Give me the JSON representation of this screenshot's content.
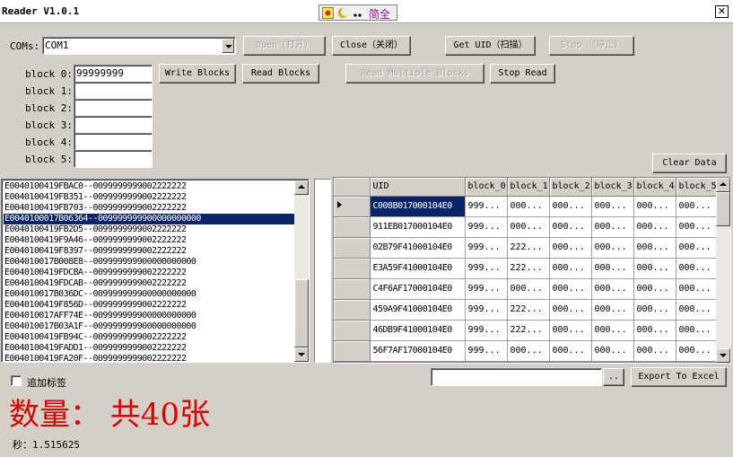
{
  "window": {
    "title": "Reader V1.0.1",
    "close_glyph": "✕"
  },
  "ime": {
    "text": "简全"
  },
  "com": {
    "label": "COMs:",
    "value": "COM1"
  },
  "buttons": {
    "open": "Open（打开）",
    "close": "Close（关闭）",
    "get_uid": "Get UID（扫描）",
    "stop": "Stop （停止）",
    "write_blocks": "Write Blocks",
    "read_blocks": "Read Blocks",
    "read_multiple": "Read Multiple Blocks",
    "stop_read": "Stop Read",
    "clear_data": "Clear Data",
    "export_excel": "Export To Excel",
    "browse": ".."
  },
  "blocks": [
    {
      "label": "block 0:",
      "value": "99999999"
    },
    {
      "label": "block 1:",
      "value": ""
    },
    {
      "label": "block 2:",
      "value": ""
    },
    {
      "label": "block 3:",
      "value": ""
    },
    {
      "label": "block 4:",
      "value": ""
    },
    {
      "label": "block 5:",
      "value": ""
    }
  ],
  "tag_list": {
    "selected_index": 3,
    "items": [
      "E0040100419FBAC0--0099999999002222222",
      "E0040100419FB351--0099999999002222222",
      "E0040100419FB703--0099999999002222222",
      "E0040100017B06364--009999999900000000000",
      "E0040100419FB2D5--0099999999002222222",
      "E0040100419F9A46--0099999999002222222",
      "E0040100419F8397--0099999999002222222",
      "E004010017B008E8--009999999900000000000",
      "E0040100419FDCBA--0099999999002222222",
      "E0040100419FDCAB--0099999999002222222",
      "E004010017B036DC--009999999900000000000",
      "E0040100419F856D--0099999999002222222",
      "E004010017AFF74E--009999999900000000000",
      "E004010017B03A1F--009999999900000000000",
      "E0040100419FB94C--0099999999002222222",
      "E0040100419FADD1--0099999999002222222",
      "E0040100419FA20F--0099999999002222222"
    ]
  },
  "grid": {
    "columns": [
      "UID",
      "block_0",
      "block_1",
      "block_2",
      "block_3",
      "block_4",
      "block_5"
    ],
    "current_row": 0,
    "rows": [
      [
        "C008B017000104E0",
        "999...",
        "000...",
        "000...",
        "000...",
        "000...",
        "000..."
      ],
      [
        "911EB017000104E0",
        "999...",
        "000...",
        "000...",
        "000...",
        "000...",
        "000..."
      ],
      [
        "02B79F41000104E0",
        "999...",
        "222...",
        "000...",
        "000...",
        "000...",
        "000..."
      ],
      [
        "E3A59F41000104E0",
        "999...",
        "222...",
        "000...",
        "000...",
        "000...",
        "000..."
      ],
      [
        "C4F6AF17000104E0",
        "999...",
        "000...",
        "000...",
        "000...",
        "000...",
        "000..."
      ],
      [
        "459A9F41000104E0",
        "999...",
        "222...",
        "000...",
        "000...",
        "000...",
        "000..."
      ],
      [
        "46DB9F41000104E0",
        "999...",
        "222...",
        "000...",
        "000...",
        "000...",
        "000..."
      ],
      [
        "56F7AF17000104E0",
        "999...",
        "000...",
        "000...",
        "000...",
        "000...",
        "000..."
      ]
    ]
  },
  "append_tag": {
    "label": "追加标签",
    "checked": false
  },
  "export_path": "",
  "count_text": "数量：  共40张",
  "time_text": "秒：1.515625"
}
